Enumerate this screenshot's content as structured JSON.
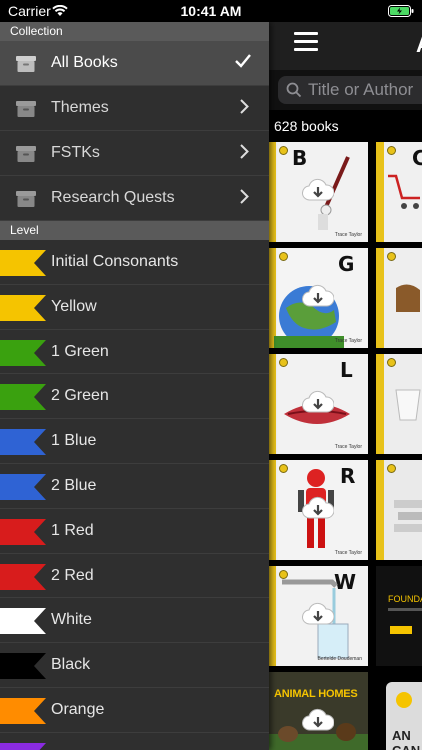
{
  "status": {
    "carrier": "Carrier",
    "time": "10:41 AM"
  },
  "app": {
    "title_partial": "A",
    "search_placeholder": "Title or Author",
    "book_count": "628 books",
    "books": [
      {
        "letter": "B",
        "author": "Trace Taylor",
        "bg": "#f2f2f2"
      },
      {
        "letter": "C",
        "author": "",
        "bg": "#f0f0f0"
      },
      {
        "letter": "G",
        "author": "Trace Taylor",
        "bg": "#f4f4f4"
      },
      {
        "letter": "",
        "author": "",
        "bg": "#eee"
      },
      {
        "letter": "L",
        "author": "Trace Taylor",
        "bg": "#f2f2f2"
      },
      {
        "letter": "",
        "author": "",
        "bg": "#ededed"
      },
      {
        "letter": "R",
        "author": "Trace Taylor",
        "bg": "#f3f3f3"
      },
      {
        "letter": "",
        "author": "",
        "bg": "#eaeaea"
      },
      {
        "letter": "W",
        "author": "Bertelde Doudeman",
        "bg": "#f2f2f2"
      },
      {
        "letter": "",
        "author": "",
        "bg": "#111"
      },
      {
        "letter": "",
        "author": "",
        "bg": "#3a3a2a"
      },
      {
        "letter": "",
        "author": "",
        "bg": "#dcdcdc"
      }
    ],
    "book_texts": {
      "foundations": "FOUNDA",
      "animal_homes": "ANIMAL HOMES",
      "an_can": "AN CAN"
    }
  },
  "drawer": {
    "collection_header": "Collection",
    "collection_items": [
      {
        "label": "All Books",
        "selected": true,
        "trail": "check-icon"
      },
      {
        "label": "Themes",
        "selected": false,
        "trail": "chevron-right-icon"
      },
      {
        "label": "FSTKs",
        "selected": false,
        "trail": "chevron-right-icon"
      },
      {
        "label": "Research Quests",
        "selected": false,
        "trail": "chevron-right-icon"
      }
    ],
    "level_header": "Level",
    "levels": [
      {
        "label": "Initial Consonants",
        "color": "#f5c400"
      },
      {
        "label": "Yellow",
        "color": "#f5c400"
      },
      {
        "label": "1 Green",
        "color": "#3aa10f"
      },
      {
        "label": "2 Green",
        "color": "#3aa10f"
      },
      {
        "label": "1 Blue",
        "color": "#2f63d4"
      },
      {
        "label": "2 Blue",
        "color": "#2f63d4"
      },
      {
        "label": "1 Red",
        "color": "#d81c1c"
      },
      {
        "label": "2 Red",
        "color": "#d81c1c"
      },
      {
        "label": "White",
        "color": "#ffffff"
      },
      {
        "label": "Black",
        "color": "#000000"
      },
      {
        "label": "Orange",
        "color": "#ff8c00"
      },
      {
        "label": "",
        "color": "#8a2be2"
      }
    ]
  }
}
